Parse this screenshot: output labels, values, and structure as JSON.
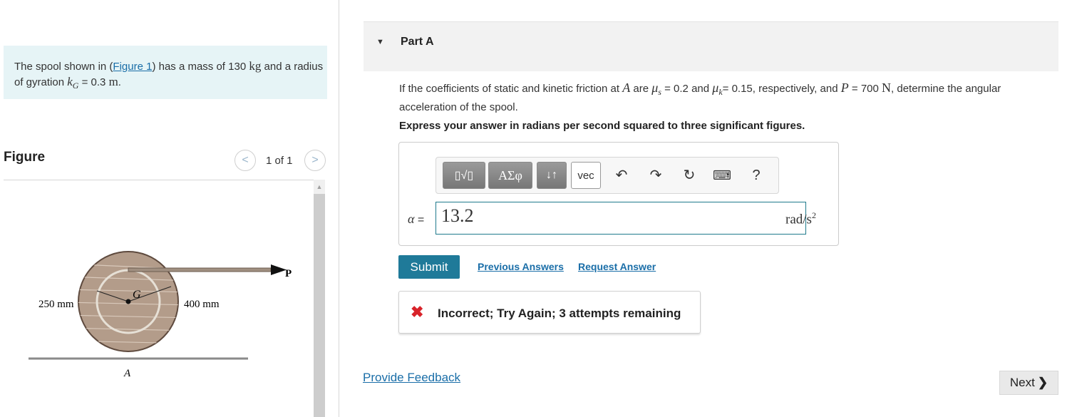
{
  "problem": {
    "text_before": "The spool shown in (",
    "figure_link": "Figure 1",
    "text_mass": ") has a mass of 130 ",
    "mass_unit": "kg",
    "text_and": " and a radius of gyration ",
    "kg_symbol": "k",
    "kg_sub": "G",
    "kg_value": " = 0.3 ",
    "kg_unit": "m",
    "end": "."
  },
  "figure": {
    "title": "Figure",
    "pager_count": "1 of 1",
    "prev_icon": "chevron-left-icon",
    "next_icon": "chevron-right-icon",
    "labels": {
      "inner_radius": "250 mm",
      "outer_radius": "400 mm",
      "center": "G",
      "contact": "A",
      "force": "P"
    }
  },
  "part": {
    "title": "Part A",
    "toggle_icon": "triangle-down-icon"
  },
  "question": {
    "t1": "If the coefficients of static and kinetic friction at ",
    "A": "A",
    "t2": " are ",
    "mu": "μ",
    "s": "s",
    "t3": " = 0.2 and ",
    "k": "k",
    "t4": "= 0.15, respectively, and ",
    "P": "P",
    "t5": " = 700 ",
    "N": "N",
    "t6": ", determine the angular acceleration of the spool."
  },
  "instruction": "Express your answer in radians per second squared to three significant figures.",
  "toolbar": {
    "templates_label": "▯√▯",
    "greek_label": "ΑΣφ",
    "arrows_label": "↓↑",
    "vec_label": "vec",
    "undo_icon": "undo-icon",
    "redo_icon": "redo-icon",
    "reset_icon": "reset-icon",
    "keyboard_icon": "keyboard-icon",
    "help_label": "?"
  },
  "answer": {
    "variable": "α",
    "equals": " =",
    "value": "13.2",
    "unit": "rad/s",
    "unit_exp": "2"
  },
  "actions": {
    "submit": "Submit",
    "previous_answers": "Previous Answers",
    "request_answer": "Request Answer"
  },
  "feedback": {
    "icon": "x-icon",
    "message": "Incorrect; Try Again; 3 attempts remaining"
  },
  "footer": {
    "provide_feedback": "Provide Feedback",
    "next": "Next"
  },
  "colors": {
    "accent": "#1f7a99",
    "link": "#1a6ea8",
    "error": "#d8232a",
    "problem_bg": "#e6f4f6"
  }
}
